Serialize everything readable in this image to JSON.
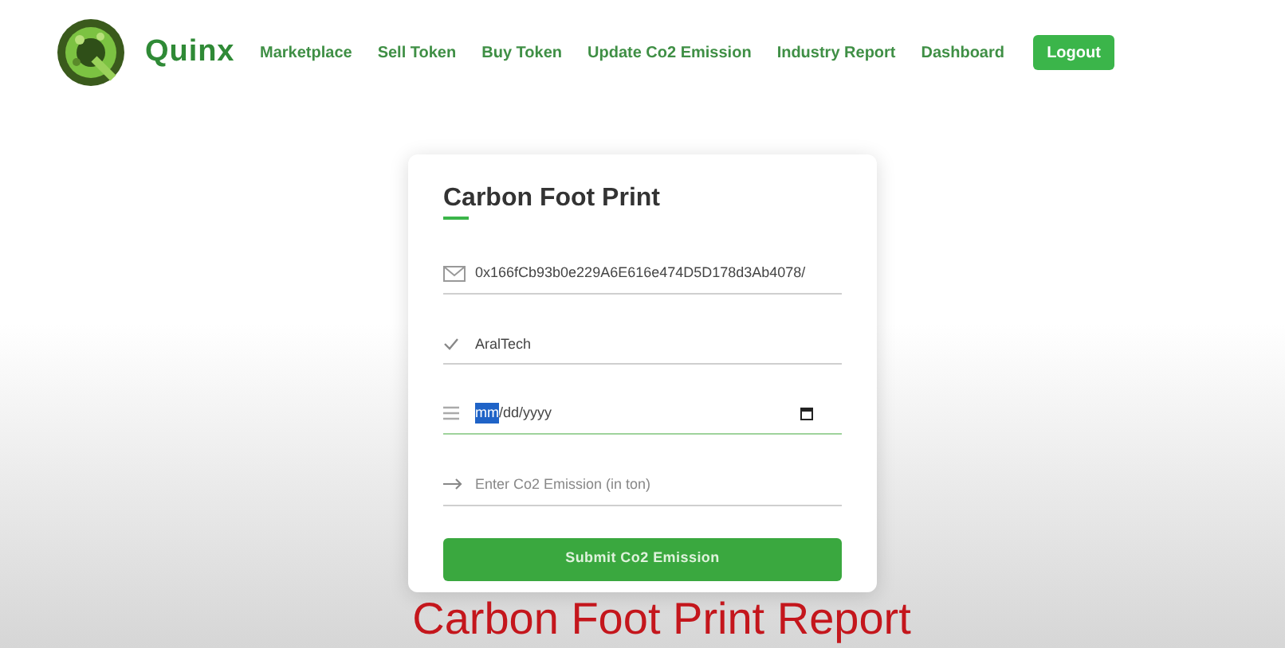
{
  "brand": {
    "name": "Quinx"
  },
  "nav": {
    "links": [
      "Marketplace",
      "Sell Token",
      "Buy Token",
      "Update Co2 Emission",
      "Industry Report",
      "Dashboard"
    ],
    "logout": "Logout"
  },
  "form": {
    "title": "Carbon Foot Print",
    "fields": [
      {
        "kind": "text",
        "value": "0x166fCb93b0e229A6E616e474D5D178d3Ab4078/",
        "focused": false
      },
      {
        "kind": "text",
        "value": "AralTech",
        "focused": false
      },
      {
        "kind": "date",
        "segments": [
          {
            "text": "mm",
            "selected": true
          },
          {
            "text": "/dd/yyyy",
            "selected": false
          }
        ],
        "focused": true
      },
      {
        "kind": "text",
        "placeholder": "Enter Co2 Emission (in ton)",
        "focused": false
      }
    ],
    "submit": "Submit Co2 Emission"
  },
  "caption": "Carbon Foot Print Report"
}
